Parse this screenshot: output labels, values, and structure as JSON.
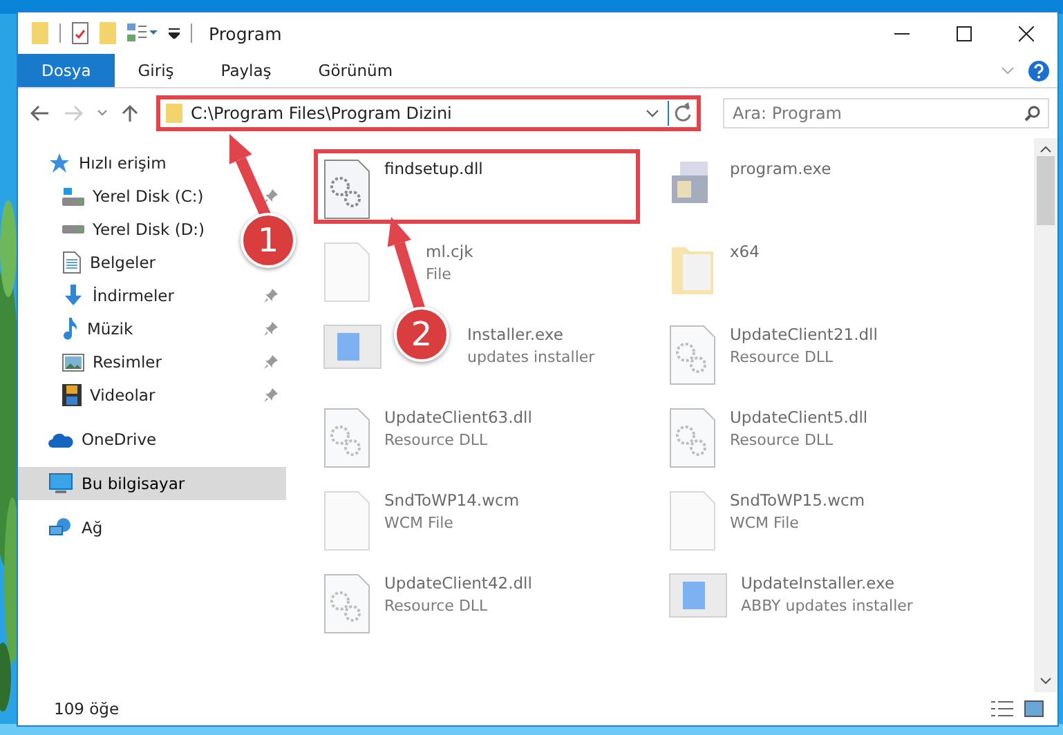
{
  "window": {
    "title": "Program"
  },
  "ribbon_tabs": [
    {
      "label": "Dosya",
      "selected": true
    },
    {
      "label": "Giriş",
      "selected": false
    },
    {
      "label": "Paylaş",
      "selected": false
    },
    {
      "label": "Görünüm",
      "selected": false
    }
  ],
  "address_bar": {
    "path": "C:\\Program Files\\Program Dizini",
    "highlighted": true
  },
  "search": {
    "placeholder": "Ara: Program"
  },
  "sidebar": {
    "items": [
      {
        "label": "Hızlı erişim",
        "kind": "star",
        "pinned": false,
        "selected": false
      },
      {
        "label": "Yerel Disk (C:)",
        "kind": "drive-c",
        "pinned": true,
        "selected": false
      },
      {
        "label": "Yerel Disk (D:)",
        "kind": "drive",
        "pinned": false,
        "selected": false
      },
      {
        "label": "Belgeler",
        "kind": "documents",
        "pinned": false,
        "selected": false
      },
      {
        "label": "İndirmeler",
        "kind": "downloads",
        "pinned": true,
        "selected": false
      },
      {
        "label": "Müzik",
        "kind": "music",
        "pinned": true,
        "selected": false
      },
      {
        "label": "Resimler",
        "kind": "pictures",
        "pinned": true,
        "selected": false
      },
      {
        "label": "Videolar",
        "kind": "videos",
        "pinned": true,
        "selected": false
      },
      {
        "label": "OneDrive",
        "kind": "cloud",
        "pinned": false,
        "selected": false
      },
      {
        "label": "Bu bilgisayar",
        "kind": "computer",
        "pinned": false,
        "selected": true
      },
      {
        "label": "Ağ",
        "kind": "network",
        "pinned": false,
        "selected": false
      }
    ]
  },
  "files": [
    {
      "name": "findsetup.dll",
      "kind": "dll",
      "faded": false,
      "highlighted": true
    },
    {
      "name": "program.exe",
      "kind": "app",
      "faded": true,
      "highlighted": false
    },
    {
      "name": "ml.cjk",
      "type": "File",
      "kind": "file",
      "faded": true,
      "highlighted": false,
      "under_arrow": true
    },
    {
      "name": "x64",
      "kind": "folder",
      "faded": true,
      "highlighted": false
    },
    {
      "name": "Installer.exe",
      "type": "updates installer",
      "kind": "installer",
      "faded": true,
      "highlighted": false,
      "under_badge": true
    },
    {
      "name": "UpdateClient21.dll",
      "type": "Resource DLL",
      "kind": "dll",
      "faded": true,
      "highlighted": false
    },
    {
      "name": "UpdateClient63.dll",
      "type": "Resource DLL",
      "kind": "dll",
      "faded": true,
      "highlighted": false
    },
    {
      "name": "UpdateClient5.dll",
      "type": "Resource DLL",
      "kind": "dll",
      "faded": true,
      "highlighted": false
    },
    {
      "name": "SndToWP14.wcm",
      "type": "WCM File",
      "kind": "file",
      "faded": true,
      "highlighted": false
    },
    {
      "name": "SndToWP15.wcm",
      "type": "WCM File",
      "kind": "file",
      "faded": true,
      "highlighted": false
    },
    {
      "name": "UpdateClient42.dll",
      "type": "Resource DLL",
      "kind": "dll",
      "faded": true,
      "highlighted": false
    },
    {
      "name": "UpdateInstaller.exe",
      "type": "ABBY updates installer",
      "kind": "installer",
      "faded": true,
      "highlighted": false
    }
  ],
  "annotations": [
    {
      "number": "1"
    },
    {
      "number": "2"
    }
  ],
  "status_bar": {
    "count": "109 öğe"
  }
}
